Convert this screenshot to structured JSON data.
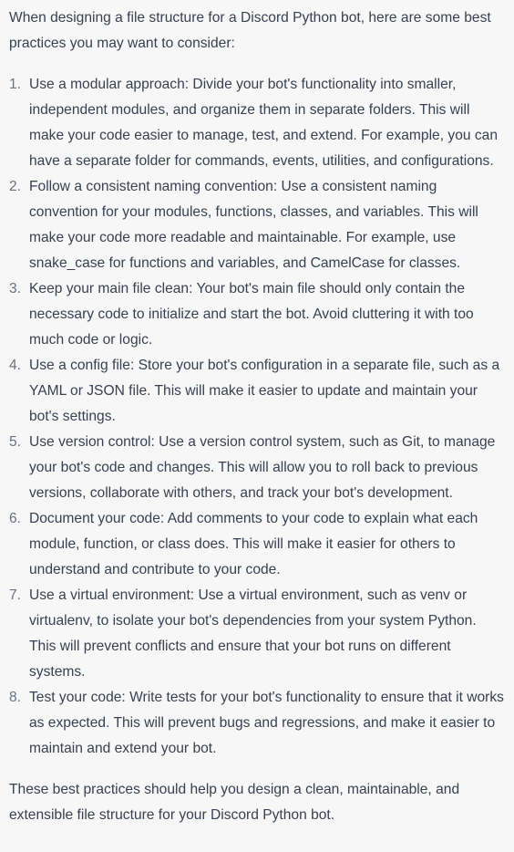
{
  "intro": "When designing a file structure for a Discord Python bot, here are some best practices you may want to consider:",
  "items": [
    {
      "num": "1.",
      "text": "Use a modular approach: Divide your bot's functionality into smaller, independent modules, and organize them in separate folders. This will make your code easier to manage, test, and extend. For example, you can have a separate folder for commands, events, utilities, and configurations."
    },
    {
      "num": "2.",
      "text": "Follow a consistent naming convention: Use a consistent naming convention for your modules, functions, classes, and variables. This will make your code more readable and maintainable. For example, use snake_case for functions and variables, and CamelCase for classes."
    },
    {
      "num": "3.",
      "text": "Keep your main file clean: Your bot's main file should only contain the necessary code to initialize and start the bot. Avoid cluttering it with too much code or logic."
    },
    {
      "num": "4.",
      "text": "Use a config file: Store your bot's configuration in a separate file, such as a YAML or JSON file. This will make it easier to update and maintain your bot's settings."
    },
    {
      "num": "5.",
      "text": "Use version control: Use a version control system, such as Git, to manage your bot's code and changes. This will allow you to roll back to previous versions, collaborate with others, and track your bot's development."
    },
    {
      "num": "6.",
      "text": "Document your code: Add comments to your code to explain what each module, function, or class does. This will make it easier for others to understand and contribute to your code."
    },
    {
      "num": "7.",
      "text": "Use a virtual environment: Use a virtual environment, such as venv or virtualenv, to isolate your bot's dependencies from your system Python. This will prevent conflicts and ensure that your bot runs on different systems."
    },
    {
      "num": "8.",
      "text": "Test your code: Write tests for your bot's functionality to ensure that it works as expected. This will prevent bugs and regressions, and make it easier to maintain and extend your bot."
    }
  ],
  "outro": "These best practices should help you design a clean, maintainable, and extensible file structure for your Discord Python bot."
}
